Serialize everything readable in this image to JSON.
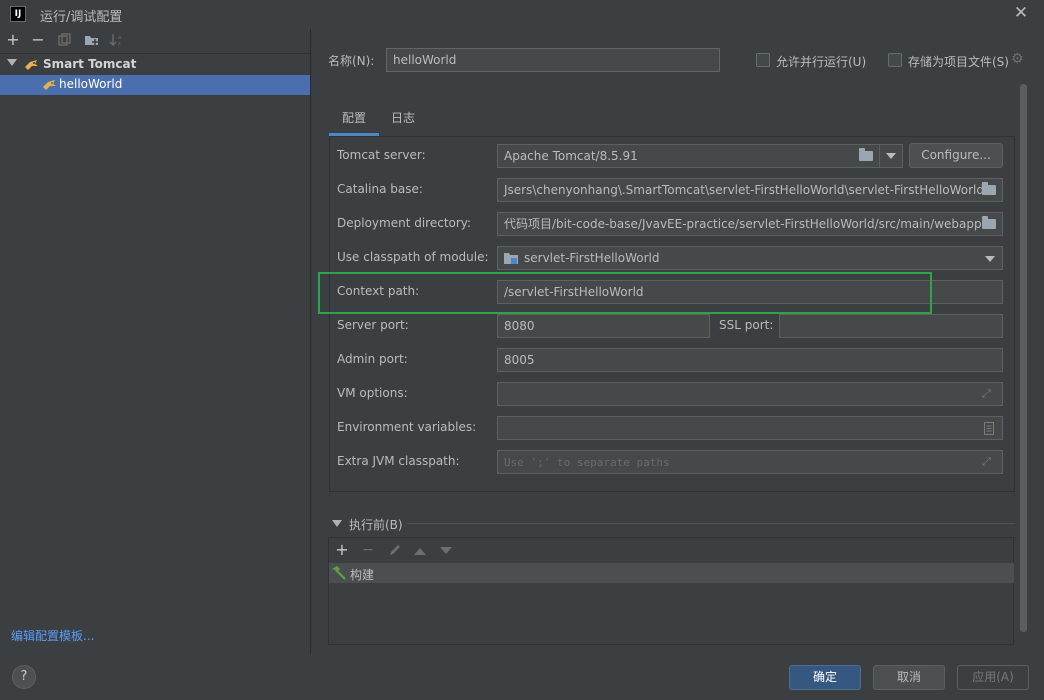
{
  "window": {
    "title": "运行/调试配置",
    "logo_text": "IJ",
    "close_glyph": "✕"
  },
  "left_toolbar": {
    "add": "+",
    "remove": "−",
    "copy": "⧉",
    "folder": "▪",
    "sort": "↓"
  },
  "tree": {
    "group_label": "Smart Tomcat",
    "child_label": "helloWorld"
  },
  "edit_templates_link": "编辑配置模板...",
  "header": {
    "name_label": "名称(N):",
    "name_value": "helloWorld",
    "parallel_label": "允许并行运行(U)",
    "store_label": "存储为项目文件(S)"
  },
  "tabs": [
    {
      "label": "配置"
    },
    {
      "label": "日志"
    }
  ],
  "form": {
    "tomcat_server": {
      "label": "Tomcat server:",
      "value": "Apache Tomcat/8.5.91",
      "configure": "Configure..."
    },
    "catalina_base": {
      "label": "Catalina base:",
      "value": "Jsers\\chenyonhang\\.SmartTomcat\\servlet-FirstHelloWorld\\servlet-FirstHelloWorld"
    },
    "deployment_directory": {
      "label": "Deployment directory:",
      "value": "代码项目/bit-code-base/JvavEE-practice/servlet-FirstHelloWorld/src/main/webapp"
    },
    "classpath_module": {
      "label": "Use classpath of module:",
      "value": "servlet-FirstHelloWorld"
    },
    "context_path": {
      "label": "Context path:",
      "value": "/servlet-FirstHelloWorld"
    },
    "server_port": {
      "label": "Server port:",
      "value": "8080"
    },
    "ssl_port": {
      "label": "SSL port:",
      "value": ""
    },
    "admin_port": {
      "label": "Admin port:",
      "value": "8005"
    },
    "vm_options": {
      "label": "VM options:",
      "value": ""
    },
    "env_vars": {
      "label": "Environment variables:",
      "value": ""
    },
    "extra_jvm": {
      "label": "Extra JVM classpath:",
      "placeholder": "Use ';' to separate paths"
    }
  },
  "before_launch": {
    "label": "执行前(B)",
    "toolbar": {
      "add": "+",
      "remove": "−"
    },
    "items": [
      {
        "label": "构建"
      }
    ]
  },
  "buttons": {
    "help": "?",
    "ok": "确定",
    "cancel": "取消",
    "apply": "应用(A)"
  },
  "colors": {
    "accent": "#4a88c7",
    "selection": "#4b6eaf",
    "highlight_box": "#2fa24a",
    "primary_button": "#365880",
    "link": "#589df6"
  }
}
